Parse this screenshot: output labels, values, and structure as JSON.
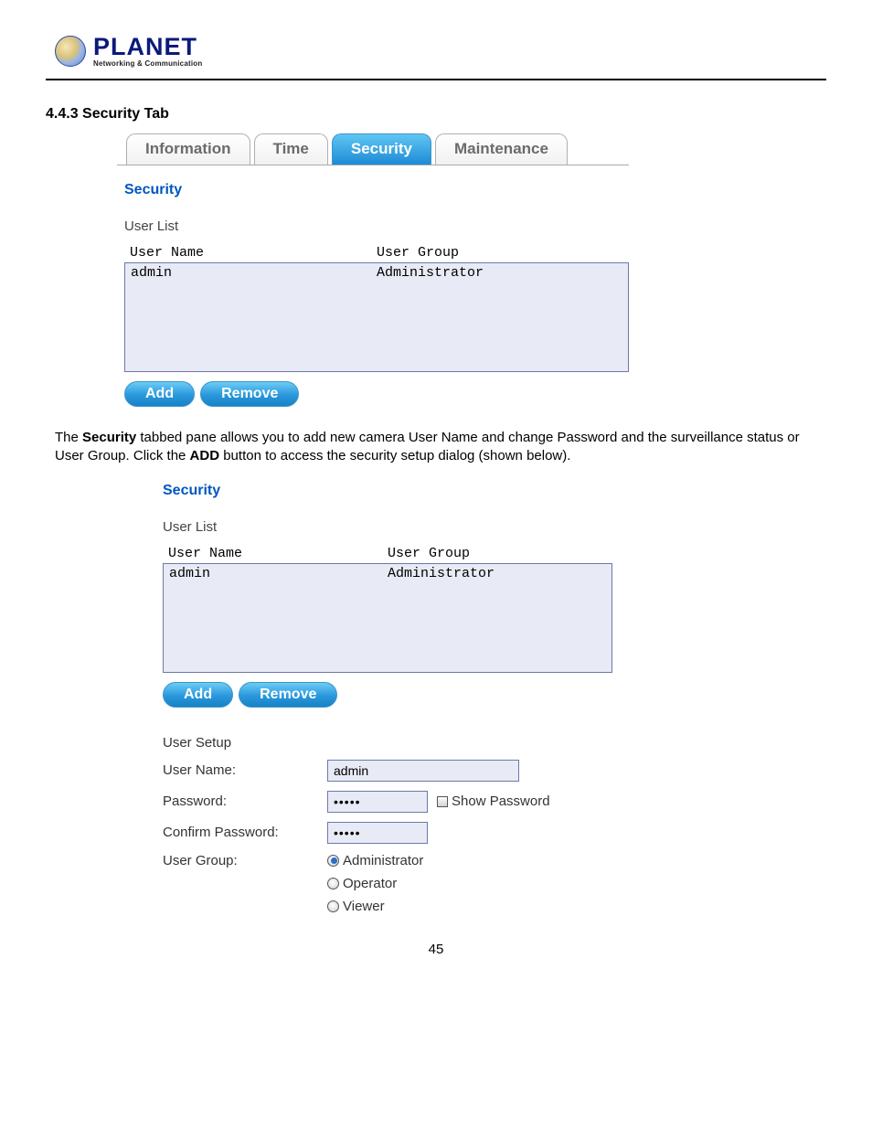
{
  "logo": {
    "name": "PLANET",
    "tagline": "Networking & Communication"
  },
  "section_heading": "4.4.3 Security Tab",
  "tabs": {
    "information": "Information",
    "time": "Time",
    "security": "Security",
    "maintenance": "Maintenance"
  },
  "panel1": {
    "title": "Security",
    "subtitle": "User List",
    "cols": {
      "name": "User Name",
      "group": "User Group"
    },
    "row": {
      "name": "admin",
      "group": "Administrator"
    },
    "btn_add": "Add",
    "btn_remove": "Remove"
  },
  "body_text": {
    "pre": "The ",
    "bold1": "Security",
    "mid": " tabbed pane allows you to add new camera User Name and change Password and the surveillance status or User Group. Click the ",
    "bold2": "ADD",
    "post": " button to access the security setup dialog (shown below)."
  },
  "panel2": {
    "title": "Security",
    "subtitle": "User List",
    "cols": {
      "name": "User Name",
      "group": "User Group"
    },
    "row": {
      "name": "admin",
      "group": "Administrator"
    },
    "btn_add": "Add",
    "btn_remove": "Remove",
    "setup_heading": "User Setup",
    "label_user": "User Name:",
    "value_user": "admin",
    "label_pw": "Password:",
    "value_pw": "•••••",
    "show_pw": "Show Password",
    "label_confirm": "Confirm Password:",
    "value_confirm": "•••••",
    "label_group": "User Group:",
    "opt_admin": "Administrator",
    "opt_operator": "Operator",
    "opt_viewer": "Viewer"
  },
  "page_number": "45"
}
